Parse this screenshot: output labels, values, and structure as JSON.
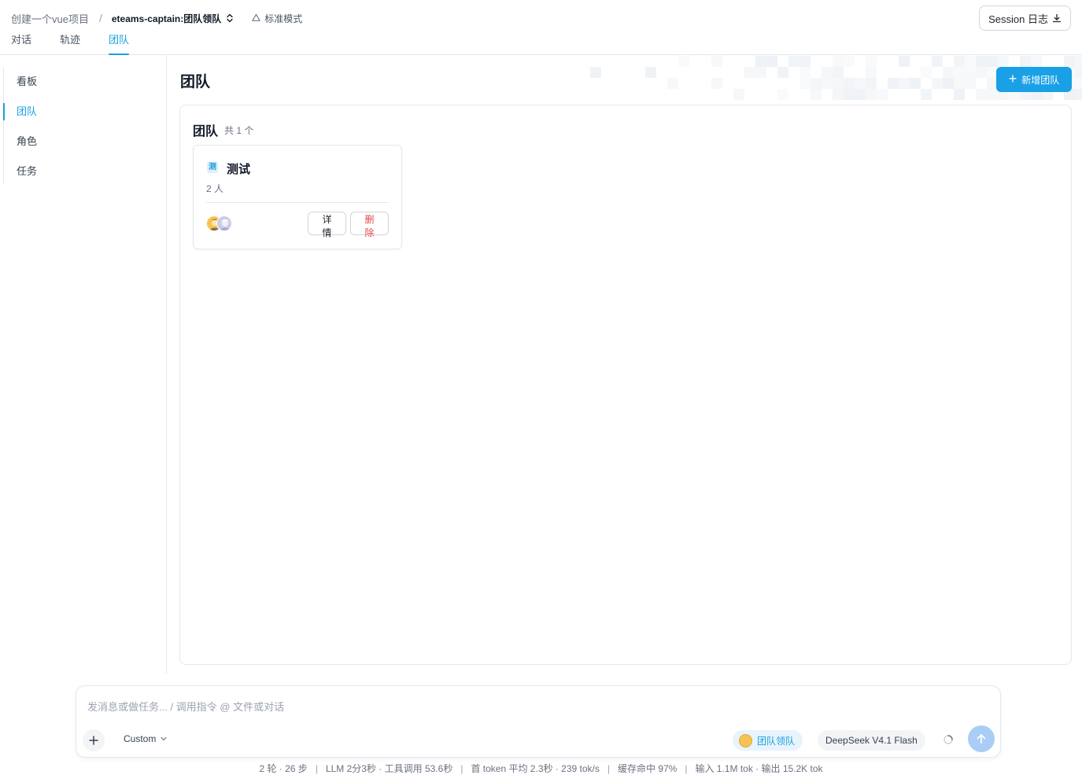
{
  "header": {
    "project": "创建一个vue项目",
    "separator": "/",
    "team_agent": "eteams-captain:团队领队",
    "mode": "标准模式",
    "session_button": "Session 日志",
    "tabs": [
      {
        "label": "对话",
        "active": false
      },
      {
        "label": "轨迹",
        "active": false
      },
      {
        "label": "团队",
        "active": true
      }
    ]
  },
  "sidebar": {
    "items": [
      {
        "label": "看板",
        "active": false
      },
      {
        "label": "团队",
        "active": true
      },
      {
        "label": "角色",
        "active": false
      },
      {
        "label": "任务",
        "active": false
      }
    ]
  },
  "main": {
    "title": "团队",
    "add_button": "新增团队",
    "panel": {
      "title": "团队",
      "count": "共 1 个",
      "teams": [
        {
          "icon_char": "测",
          "name": "测试",
          "members": "2 人",
          "detail_button": "详情",
          "delete_button": "删除"
        }
      ]
    }
  },
  "composer": {
    "placeholder": "发消息或做任务... / 调用指令 @ 文件或对话",
    "mode_select": "Custom",
    "agent_chip": "团队领队",
    "model_chip": "DeepSeek V4.1 Flash"
  },
  "statusbar": {
    "rounds": "2 轮 · 26 步",
    "llm": "LLM 2分3秒 · 工具调用 53.6秒",
    "first_token": "首 token 平均 2.3秒 · 239 tok/s",
    "cache": "缓存命中 97%",
    "io": "输入 1.1M tok · 输出 15.2K tok",
    "sep": "|"
  },
  "colors": {
    "accent": "#1aa0e6",
    "danger": "#e5484d",
    "send_disabled": "#a9cdf5"
  }
}
